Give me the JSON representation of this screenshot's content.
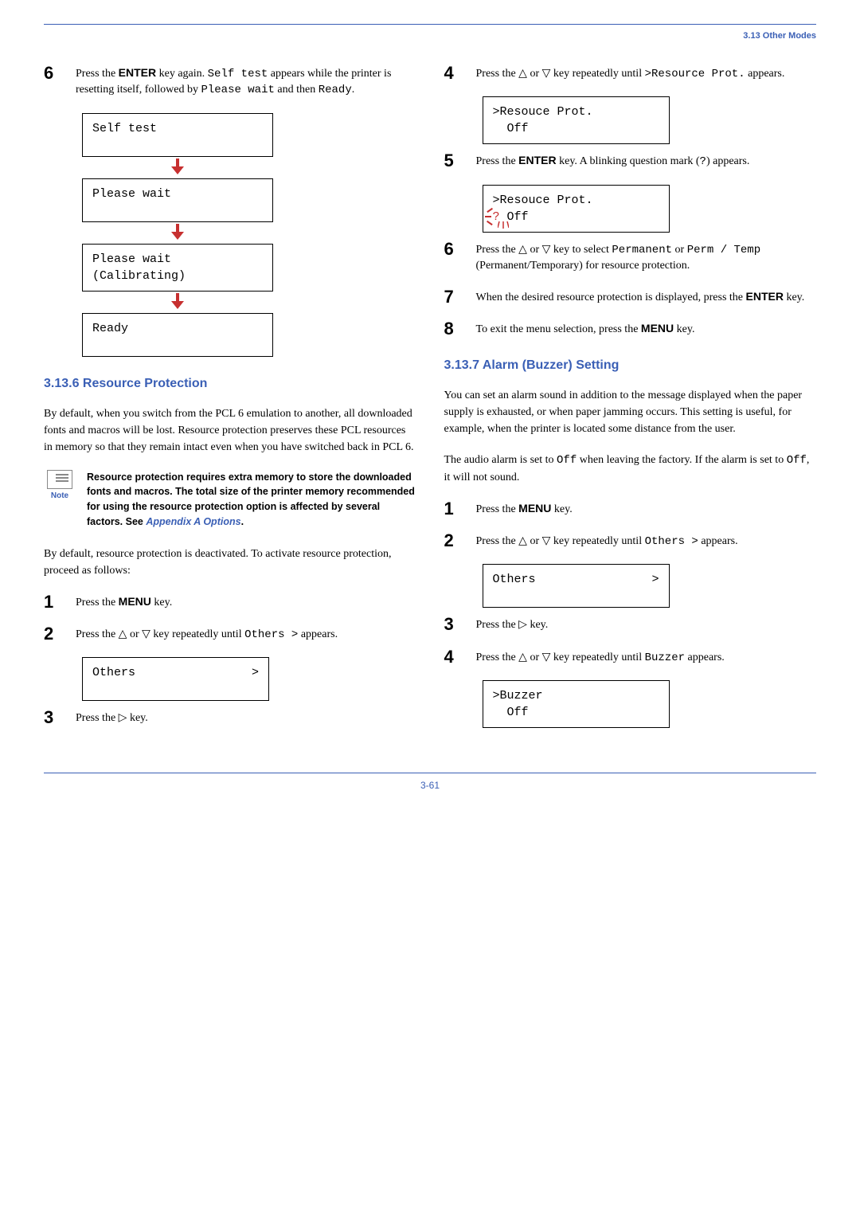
{
  "header": {
    "section": "3.13 Other Modes"
  },
  "left": {
    "step6": {
      "text_a": "Press the ",
      "key": "ENTER",
      "text_b": " key again. ",
      "code1": "Self test",
      "text_c": " appears while the printer is resetting itself, followed by ",
      "code2": "Please wait",
      "text_d": " and then ",
      "code3": "Ready",
      "text_e": "."
    },
    "lcd": {
      "box1": "Self test",
      "box2": "Please wait",
      "box3a": "Please wait",
      "box3b": "(Calibrating)",
      "box4": "Ready"
    },
    "h_resource": "3.13.6   Resource Protection",
    "resource_intro": "By default, when you switch from the PCL 6 emulation to another, all downloaded fonts and macros will be lost. Resource protection preserves these PCL resources in memory so that they remain intact even when you have switched back in PCL 6.",
    "note": {
      "label": "Note",
      "text_a": "Resource protection requires extra memory to store the downloaded fonts and macros. The total size of the printer memory recommended for using the resource protection option is affected by several factors. See ",
      "link": "Appendix A Options",
      "text_b": "."
    },
    "resource_default": "By default, resource protection is deactivated. To activate resource protection, proceed as follows:",
    "rp1": {
      "a": "Press the ",
      "key": "MENU",
      "b": " key."
    },
    "rp2": {
      "a": "Press the ",
      "b": " or ",
      "c": " key repeatedly until ",
      "code": "Others >",
      "d": " appears."
    },
    "rp2_lcd_a": "Others",
    "rp2_lcd_b": ">",
    "rp3": {
      "a": "Press the ",
      "b": " key."
    }
  },
  "right": {
    "s4": {
      "a": "Press the ",
      "b": " or ",
      "c": " key repeatedly until ",
      "code": ">Resource Prot.",
      "d": " appears."
    },
    "s4_lcd_a": ">Resouce Prot.",
    "s4_lcd_b": "  Off",
    "s5": {
      "a": "Press the ",
      "key": "ENTER",
      "b": " key. A blinking question mark (",
      "q": "?",
      "c": ") appears."
    },
    "s5_lcd_a": ">Resouce Prot.",
    "s5_lcd_b": " Off",
    "s5_q": "?",
    "s6": {
      "a": "Press the ",
      "b": " or ",
      "c": " key to select ",
      "code1": "Permanent",
      "d": " or ",
      "code2": "Perm / Temp",
      "e": " (Permanent/Temporary) for resource protection."
    },
    "s7": {
      "a": "When the desired resource protection is displayed, press the ",
      "key": "ENTER",
      "b": " key."
    },
    "s8": {
      "a": "To exit the menu selection, press the ",
      "key": "MENU",
      "b": " key."
    },
    "h_alarm": "3.13.7   Alarm (Buzzer) Setting",
    "alarm_p1": "You can set an alarm sound in addition to the message displayed when the paper supply is exhausted, or when paper jamming occurs. This setting is useful, for example, when the printer is located some distance from the user.",
    "alarm_p2_a": "The audio alarm is set to ",
    "alarm_p2_code": "Off",
    "alarm_p2_b": " when leaving the factory. If the alarm is set to ",
    "alarm_p2_code2": "Off",
    "alarm_p2_c": ", it will not sound.",
    "a1": {
      "a": "Press the ",
      "key": "MENU",
      "b": " key."
    },
    "a2": {
      "a": "Press the ",
      "b": " or ",
      "c": " key repeatedly until ",
      "code": "Others >",
      "d": " appears."
    },
    "a2_lcd_a": "Others",
    "a2_lcd_b": ">",
    "a3": {
      "a": "Press the ",
      "b": " key."
    },
    "a4": {
      "a": "Press the ",
      "b": " or ",
      "c": " key repeatedly until ",
      "code": "Buzzer",
      "d": " appears."
    },
    "a4_lcd_a": ">Buzzer",
    "a4_lcd_b": "  Off"
  },
  "footer": {
    "page": "3-61"
  },
  "glyph": {
    "up_tri": "△",
    "down_tri": "▽",
    "right_tri": "▷"
  }
}
